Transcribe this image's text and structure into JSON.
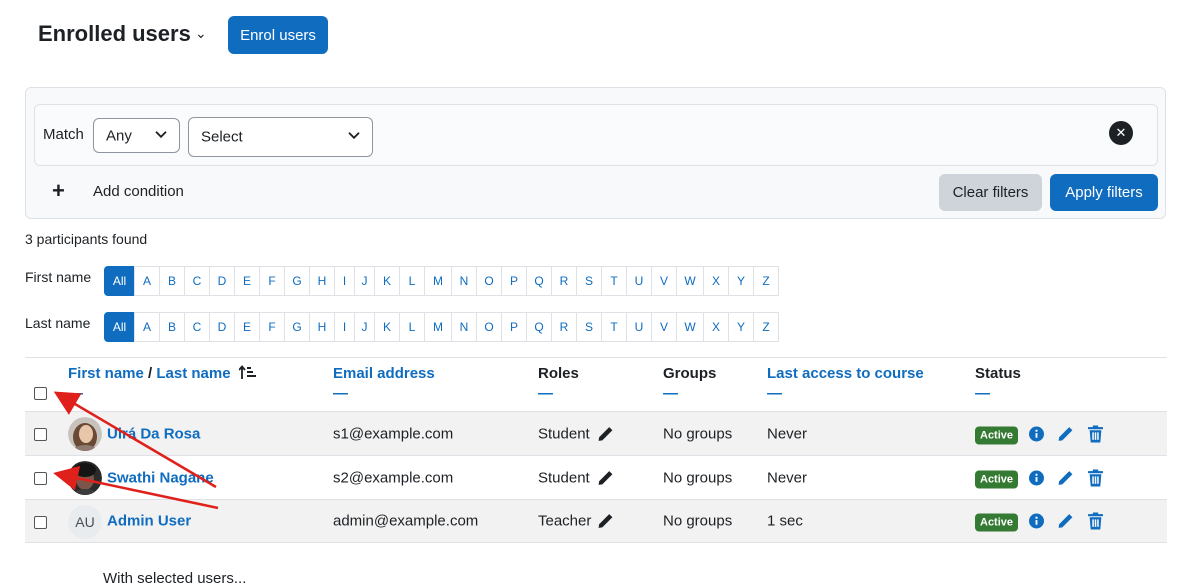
{
  "header": {
    "title": "Enrolled users",
    "title_caret": "⌄",
    "enrol_button": "Enrol users"
  },
  "filter": {
    "match_label": "Match",
    "match_value": "Any",
    "field_value": "Select",
    "remove_icon": "✕",
    "add_icon": "+",
    "add_condition": "Add condition",
    "clear_button": "Clear filters",
    "apply_button": "Apply filters"
  },
  "participants_found": "3 participants found",
  "initials": {
    "first_label": "First name",
    "last_label": "Last name",
    "all": "All",
    "letters": [
      "A",
      "B",
      "C",
      "D",
      "E",
      "F",
      "G",
      "H",
      "I",
      "J",
      "K",
      "L",
      "M",
      "N",
      "O",
      "P",
      "Q",
      "R",
      "S",
      "T",
      "U",
      "V",
      "W",
      "X",
      "Y",
      "Z"
    ]
  },
  "table": {
    "columns": {
      "first_name": "First name",
      "separator": "/",
      "last_name": "Last name",
      "email": "Email address",
      "roles": "Roles",
      "groups": "Groups",
      "last_access": "Last access to course",
      "status": "Status",
      "collapse": "—"
    },
    "rows": [
      {
        "name": "Uirá Da Rosa",
        "email": "s1@example.com",
        "role": "Student",
        "groups": "No groups",
        "last_access": "Never",
        "status": "Active"
      },
      {
        "name": "Swathi Nagane",
        "email": "s2@example.com",
        "role": "Student",
        "groups": "No groups",
        "last_access": "Never",
        "status": "Active"
      },
      {
        "name": "Admin User",
        "email": "admin@example.com",
        "role": "Teacher",
        "groups": "No groups",
        "last_access": "1 sec",
        "status": "Active",
        "initials": "AU"
      }
    ]
  },
  "footer": {
    "with_selected": "With selected users..."
  },
  "colors": {
    "primary": "#0f6cbf",
    "active_badge": "#357a32",
    "annotation_arrow": "#e0201b"
  }
}
